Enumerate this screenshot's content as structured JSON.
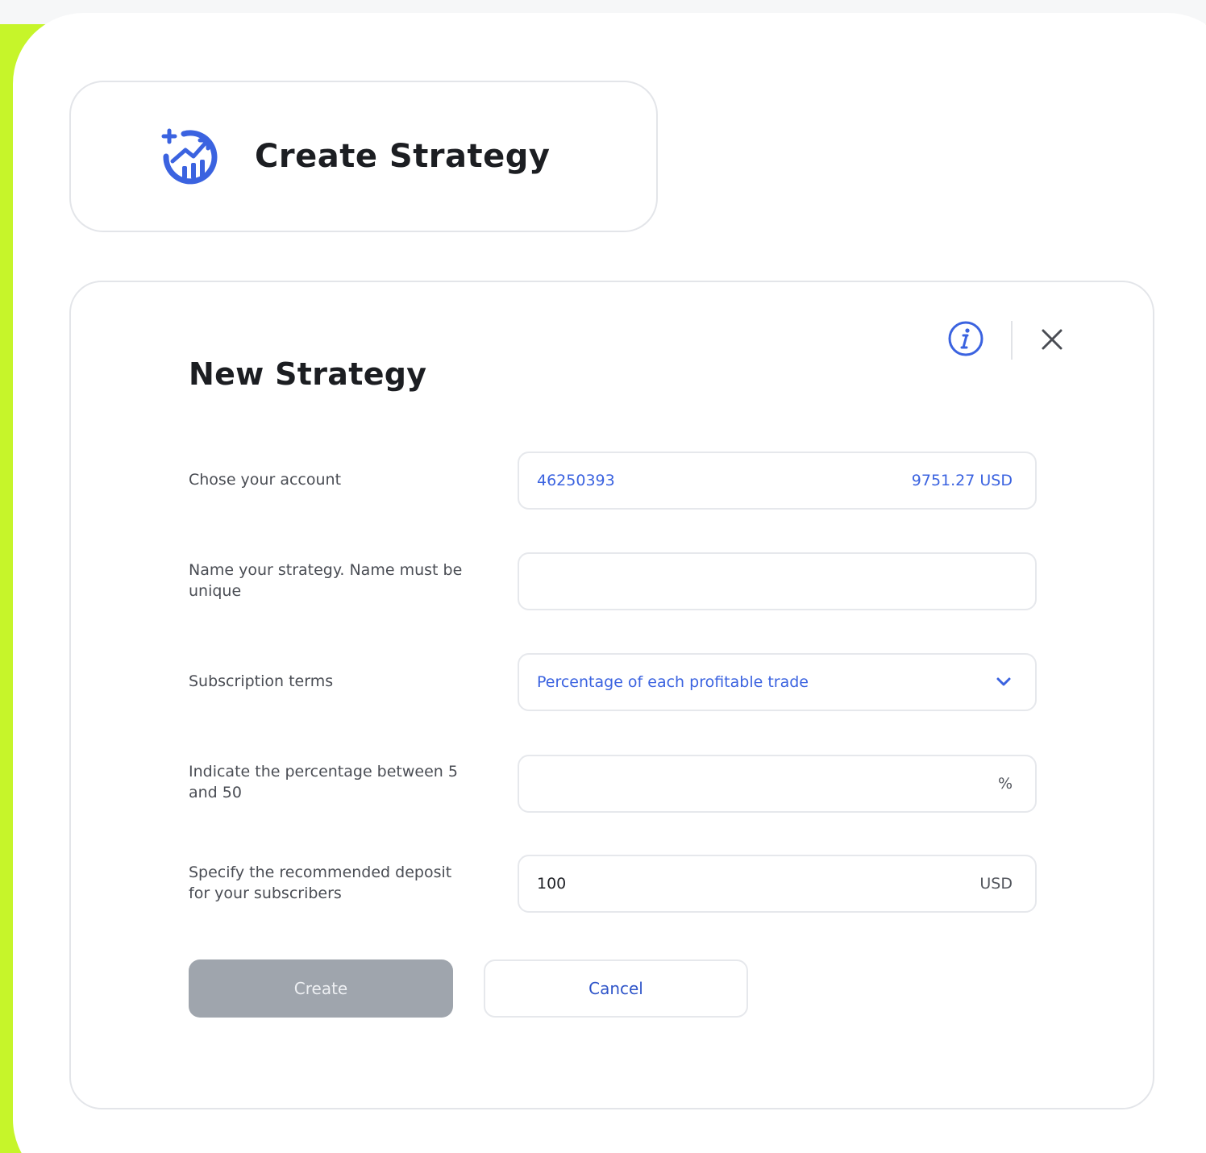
{
  "trigger": {
    "title": "Create Strategy",
    "icon": "strategy-chart-icon"
  },
  "modal": {
    "title": "New Strategy",
    "info_icon": "info-icon",
    "close_icon": "close-icon",
    "fields": {
      "account": {
        "label": "Chose your account",
        "account_number": "46250393",
        "balance": "9751.27 USD"
      },
      "name": {
        "label": "Name your strategy. Name must be unique",
        "value": ""
      },
      "terms": {
        "label": "Subscription terms",
        "selected": "Percentage of each profitable trade",
        "icon": "chevron-down-icon"
      },
      "percentage": {
        "label": "Indicate the percentage between 5 and 50",
        "value": "",
        "suffix": "%"
      },
      "deposit": {
        "label": "Specify the recommended deposit for your subscribers",
        "value": "100",
        "suffix": "USD"
      }
    },
    "buttons": {
      "create": "Create",
      "cancel": "Cancel"
    }
  },
  "colors": {
    "accent_blue": "#3b63e0",
    "background_green": "#c6f52a",
    "disabled_button": "#9fa5ad"
  }
}
